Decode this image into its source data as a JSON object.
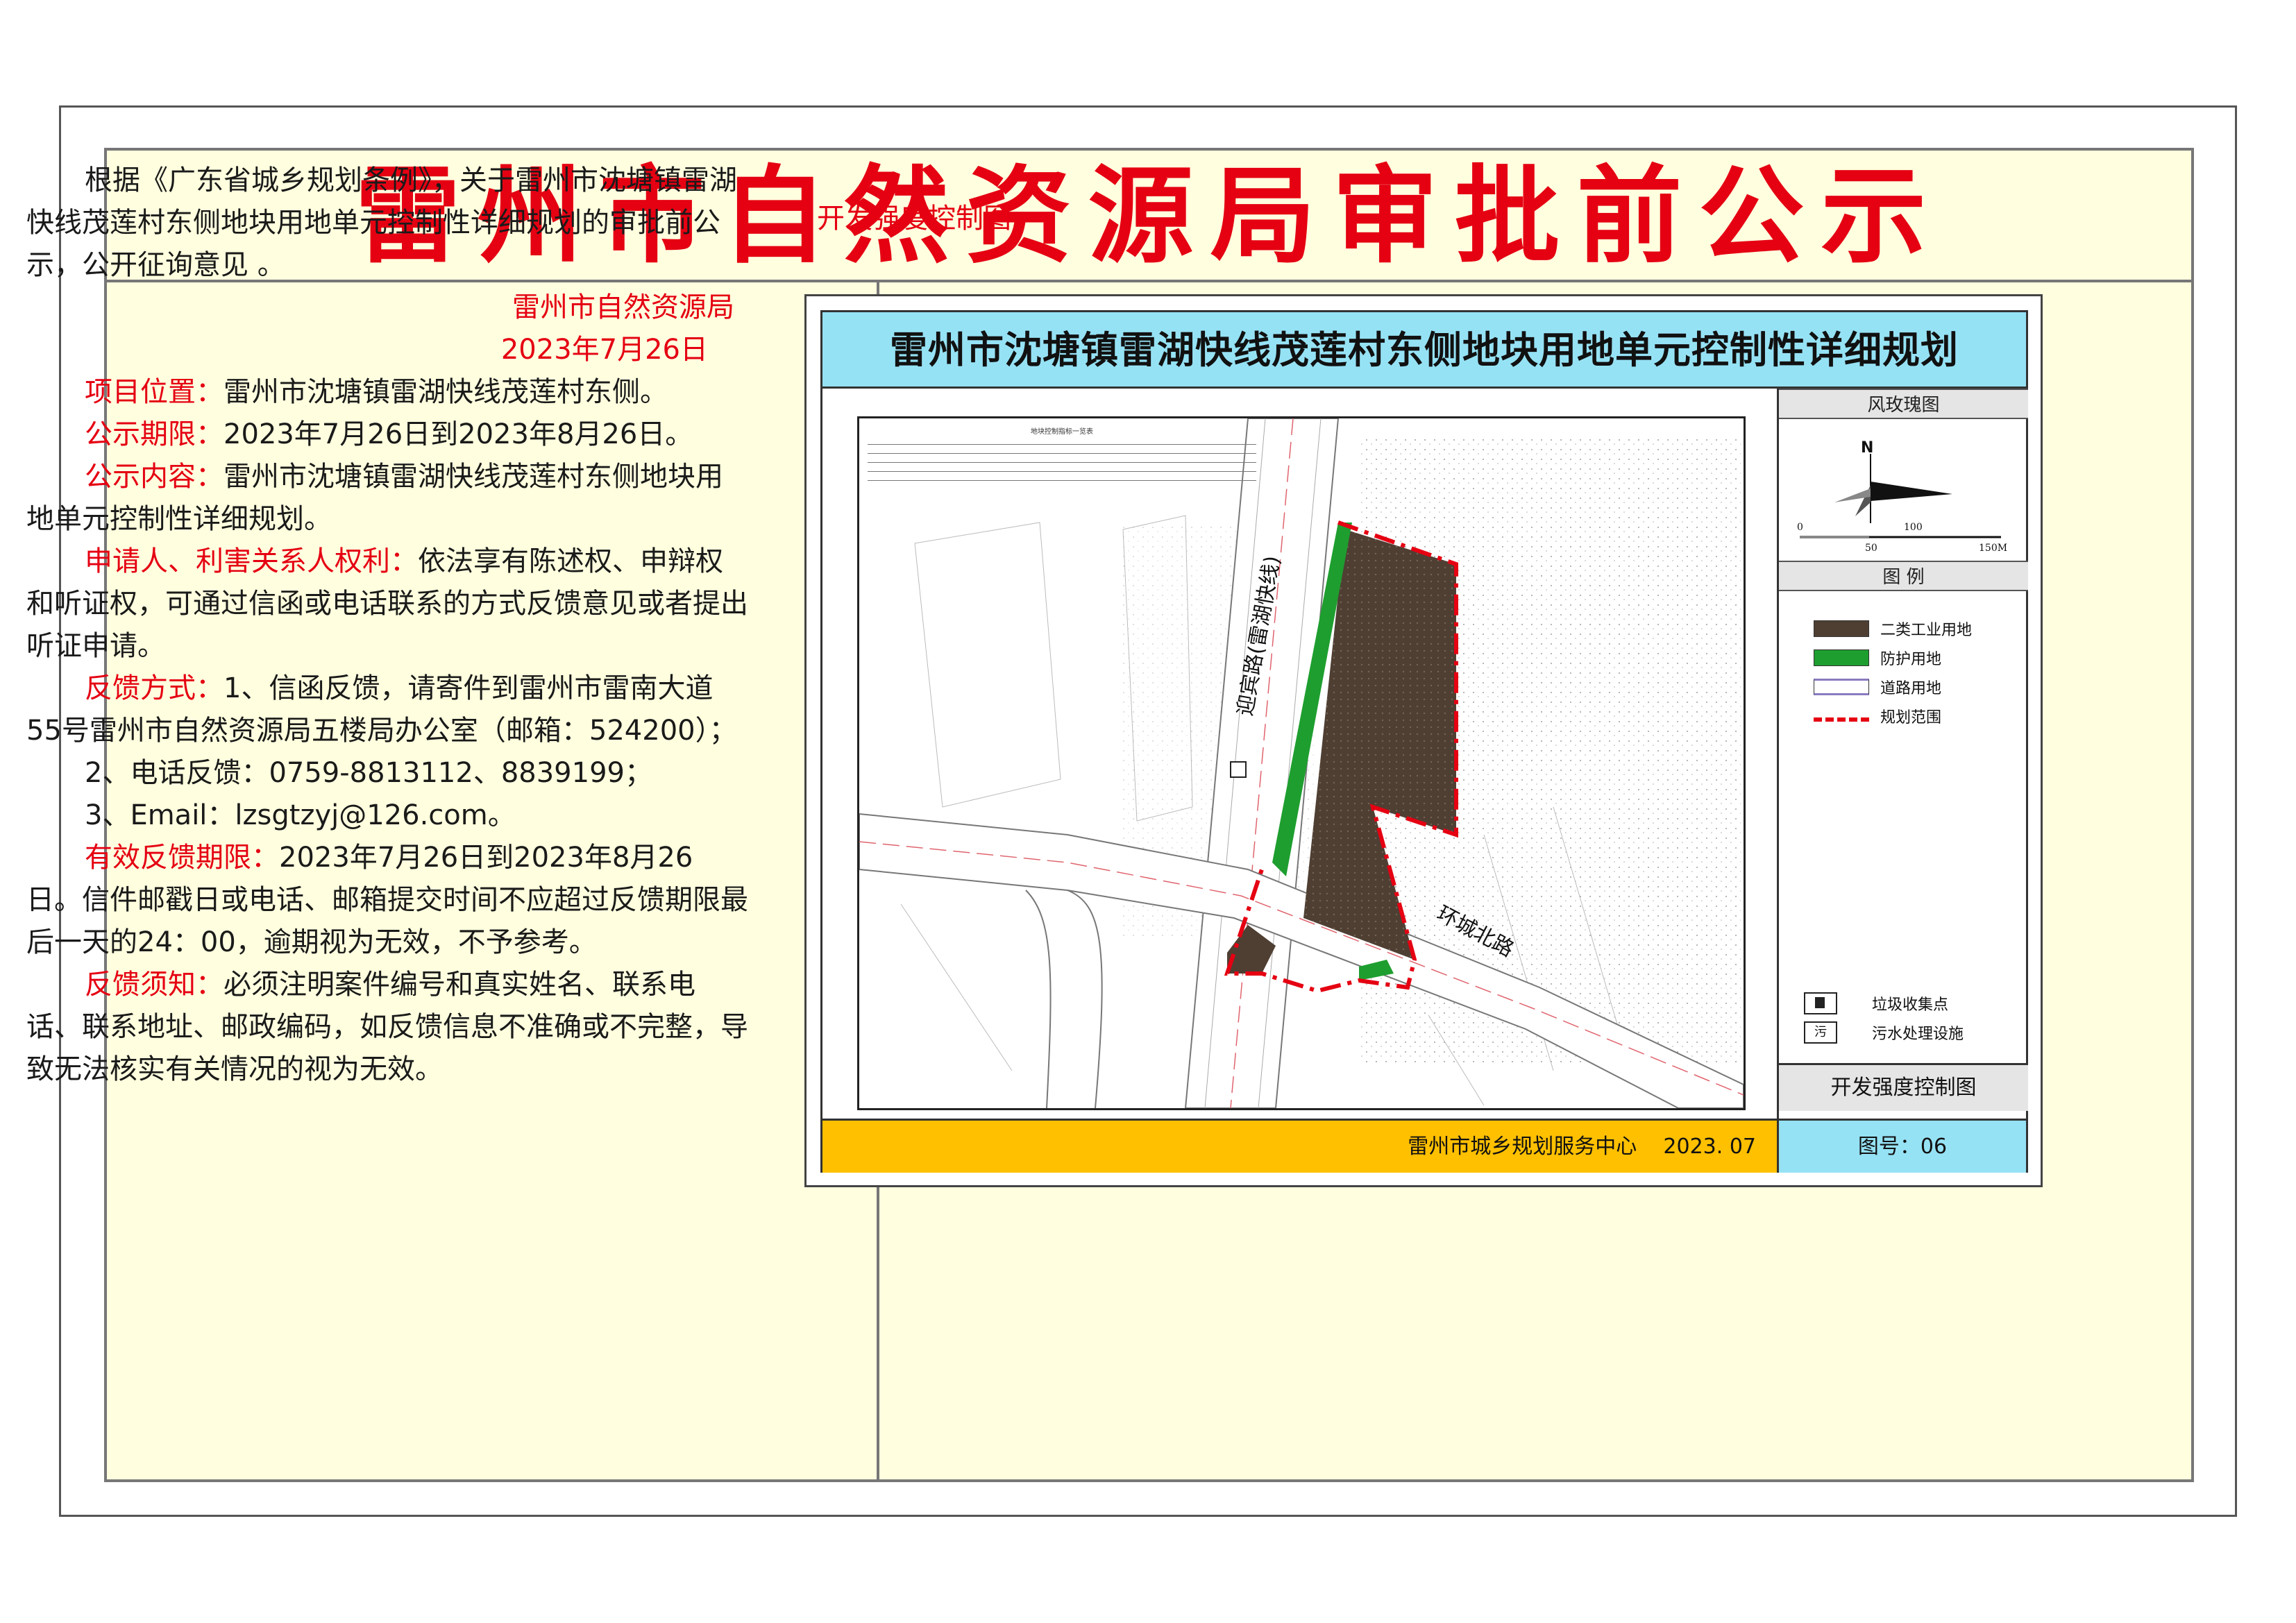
{
  "header": {
    "title": "雷州市自然资源局审批前公示"
  },
  "notice": {
    "intro": "根据《广东省城乡规划条例》，关于雷州市沈塘镇雷湖快线茂莲村东侧地块用地单元控制性详细规划的审批前公示，公开征询意见 。",
    "issuer": "雷州市自然资源局",
    "date": "2023年7月26日",
    "items": [
      {
        "label": "项目位置：",
        "text": "雷州市沈塘镇雷湖快线茂莲村东侧。"
      },
      {
        "label": "公示期限：",
        "text": "2023年7月26日到2023年8月26日。"
      },
      {
        "label": "公示内容：",
        "text": "雷州市沈塘镇雷湖快线茂莲村东侧地块用地单元控制性详细规划。"
      },
      {
        "label": "申请人、利害关系人权利：",
        "text": "依法享有陈述权、申辩权和听证权，可通过信函或电话联系的方式反馈意见或者提出听证申请。"
      },
      {
        "label": "反馈方式：",
        "text": "1、信函反馈，请寄件到雷州市雷南大道55号雷州市自然资源局五楼局办公室（邮箱：524200）；"
      }
    ],
    "feedback_phone": "2、电话反馈：0759-8813112、8839199；",
    "feedback_email": "3、Email：lzsgtzyj@126.com。",
    "items2": [
      {
        "label": "有效反馈期限：",
        "text": "2023年7月26日到2023年8月26日。信件邮戳日或电话、邮箱提交时间不应超过反馈期限最后一天的24：00，逾期视为无效，不予参考。"
      },
      {
        "label": "反馈须知：",
        "text": "必须注明案件编号和真实姓名、联系电话、联系地址、邮政编码，如反馈信息不准确或不完整，导致无法核实有关情况的视为无效。"
      }
    ]
  },
  "map": {
    "caption": "开发强度控制图",
    "title": "雷州市沈塘镇雷湖快线茂莲村东侧地块用地单元控制性详细规划",
    "table_title": "地块控制指标一览表",
    "road_vertical": "迎宾路(雷湖快线)",
    "road_horizontal": "环城北路",
    "compass_head": "风玫瑰图",
    "north": "N",
    "scale": [
      "0",
      "50",
      "100",
      "150M"
    ],
    "legend_head": "图 例",
    "legend": [
      {
        "label": "二类工业用地",
        "color": "#4f3f33",
        "icon": "industrial-swatch"
      },
      {
        "label": "防护用地",
        "color": "#1e9e2f",
        "icon": "green-swatch"
      },
      {
        "label": "道路用地",
        "color": "#ffffff",
        "icon": "road-swatch"
      },
      {
        "label": "规划范围",
        "color": "#e50012",
        "icon": "boundary-swatch"
      }
    ],
    "facilities": [
      {
        "label": "垃圾收集点",
        "icon": "trash-icon"
      },
      {
        "label": "污水处理设施",
        "icon": "sewage-icon",
        "glyph": "污"
      }
    ],
    "panel_footer": "开发强度控制图",
    "org": "雷州市城乡规划服务中心",
    "org_date": "2023. 07",
    "figure_no": "图号：06"
  },
  "colors": {
    "title_red": "#e50012",
    "board_bg": "#ffffdf",
    "map_title_bg": "#96e2f5",
    "bottom_bar": "#ffc000"
  }
}
